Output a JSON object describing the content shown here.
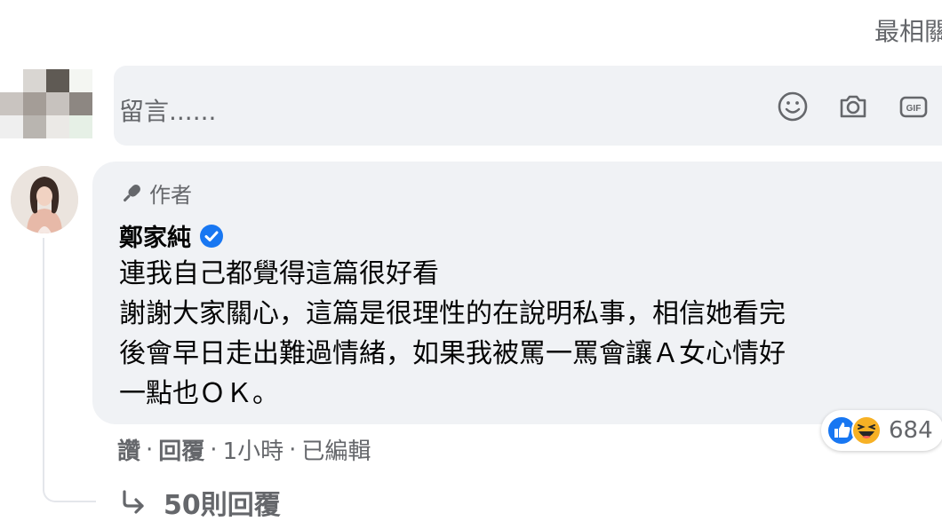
{
  "sort": {
    "label": "最相關"
  },
  "composer": {
    "placeholder": "留言......",
    "icons": [
      "emoji-icon",
      "camera-icon",
      "gif-icon"
    ]
  },
  "comment": {
    "badge_label": "作者",
    "author_name": "鄭家純",
    "verified": true,
    "text_lines": [
      "連我自己都覺得這篇很好看",
      "謝謝大家關心，這篇是很理性的在說明私事，相信她看完",
      "後會早日走出難過情緒，如果我被罵一罵會讓Ａ女心情好",
      "一點也ＯＫ。"
    ],
    "reactions": {
      "types": [
        "like",
        "haha"
      ],
      "count": "684"
    },
    "actions": {
      "like": "讚",
      "reply": "回覆",
      "time": "1小時",
      "edited": "已編輯",
      "separator": "·"
    },
    "replies_label": "50則回覆"
  },
  "colors": {
    "bubble_bg": "#f0f2f5",
    "secondary_text": "#65676b",
    "verified_blue": "#1877f2",
    "like_blue": "#1877f2",
    "haha_yellow": "#f7b125"
  }
}
